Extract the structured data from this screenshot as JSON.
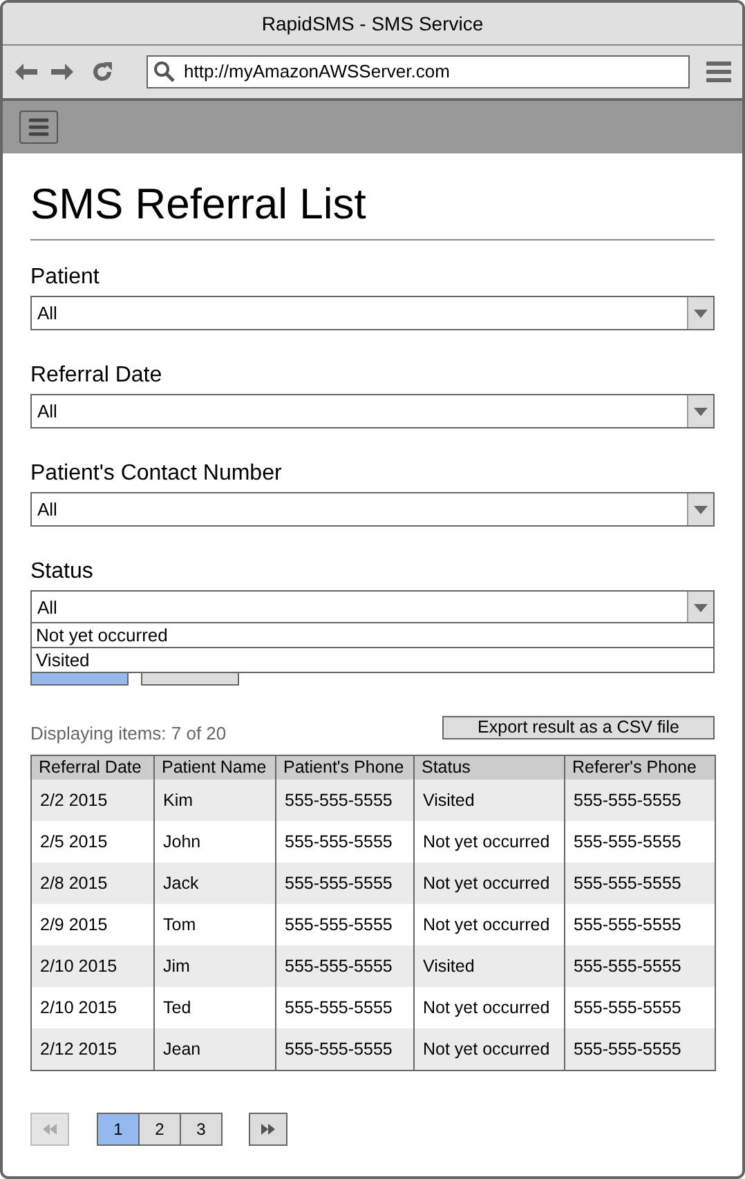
{
  "window": {
    "title": "RapidSMS - SMS Service"
  },
  "browser": {
    "url": "http://myAmazonAWSServer.com"
  },
  "page": {
    "title": "SMS Referral List"
  },
  "filters": [
    {
      "label": "Patient",
      "value": "All",
      "expanded": false
    },
    {
      "label": "Referral Date",
      "value": "All",
      "expanded": false
    },
    {
      "label": "Patient's Contact Number",
      "value": "All",
      "expanded": false
    },
    {
      "label": "Status",
      "value": "All",
      "expanded": true,
      "options": [
        "Not yet occurred",
        "Visited"
      ]
    }
  ],
  "buttons": [
    {
      "kind": "primary"
    },
    {
      "kind": "secondary"
    }
  ],
  "summary": "Displaying items: 7 of 20",
  "export_button": "Export result as a CSV file",
  "table": {
    "columns": [
      "Referral Date",
      "Patient Name",
      "Patient's Phone",
      "Status",
      "Referer's Phone"
    ],
    "rows": [
      [
        "2/2 2015",
        "Kim",
        "555-555-5555",
        "Visited",
        "555-555-5555"
      ],
      [
        "2/5 2015",
        "John",
        "555-555-5555",
        "Not yet occurred",
        "555-555-5555"
      ],
      [
        "2/8 2015",
        "Jack",
        "555-555-5555",
        "Not yet occurred",
        "555-555-5555"
      ],
      [
        "2/9 2015",
        "Tom",
        "555-555-5555",
        "Not yet occurred",
        "555-555-5555"
      ],
      [
        "2/10 2015",
        "Jim",
        "555-555-5555",
        "Visited",
        "555-555-5555"
      ],
      [
        "2/10 2015",
        "Ted",
        "555-555-5555",
        "Not yet occurred",
        "555-555-5555"
      ],
      [
        "2/12 2015",
        "Jean",
        "555-555-5555",
        "Not yet occurred",
        "555-555-5555"
      ]
    ]
  },
  "pagination": {
    "first": {
      "disabled": true
    },
    "last": {
      "disabled": false
    },
    "pages": [
      {
        "label": "1",
        "selected": true
      },
      {
        "label": "2",
        "selected": false
      },
      {
        "label": "3",
        "selected": false
      }
    ]
  }
}
